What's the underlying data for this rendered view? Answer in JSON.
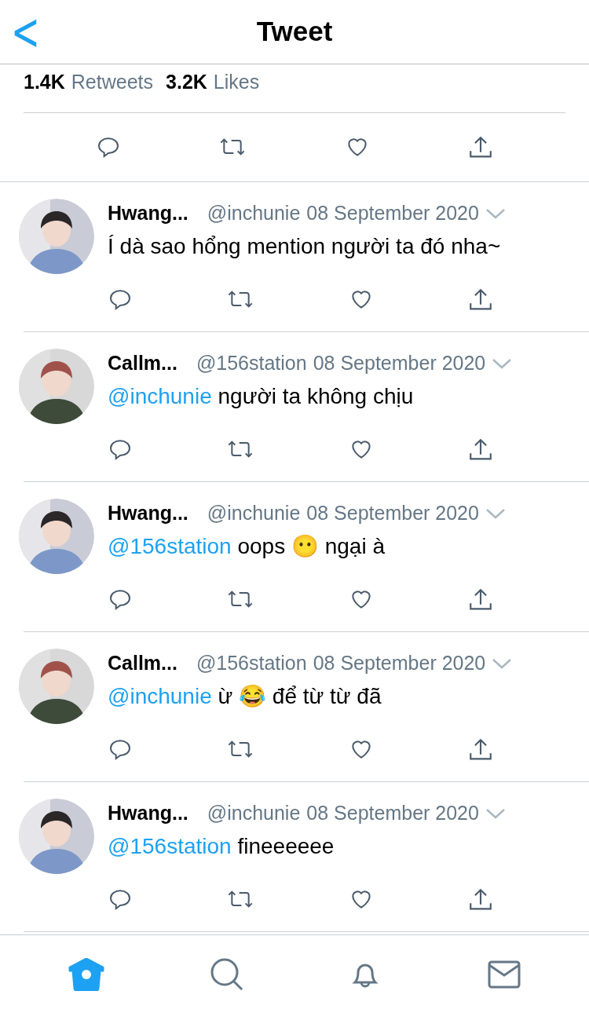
{
  "header": {
    "back": "<",
    "title": "Tweet"
  },
  "stats": [
    {
      "count": "1.4K",
      "label": "Retweets"
    },
    {
      "count": "3.2K",
      "label": "Likes"
    }
  ],
  "replies": [
    {
      "name": "Hwang...",
      "handle": "@inchunie",
      "date": "08 September 2020",
      "kind": "a",
      "text": "Í dà sao hổng mention người ta đó nha~"
    },
    {
      "name": "Callm...",
      "handle": "@156station",
      "date": "08 September 2020",
      "kind": "b",
      "mention": "@inchunie",
      "text": " người ta không chịu"
    },
    {
      "name": "Hwang...",
      "handle": "@inchunie",
      "date": "08 September 2020",
      "kind": "a",
      "mention": "@156station",
      "text": " oops 😶 ngại à"
    },
    {
      "name": "Callm...",
      "handle": "@156station",
      "date": "08 September 2020",
      "kind": "b",
      "mention": "@inchunie",
      "text": " ừ 😂 để từ từ đã"
    },
    {
      "name": "Hwang...",
      "handle": "@inchunie",
      "date": "08 September 2020",
      "kind": "a",
      "mention": "@156station",
      "text": " fineeeeee"
    }
  ],
  "tab_bar": [
    {
      "kind": "home",
      "selected": true
    },
    {
      "kind": "search",
      "selected": false
    },
    {
      "kind": "notifications",
      "selected": false
    },
    {
      "kind": "messages",
      "selected": false
    }
  ]
}
